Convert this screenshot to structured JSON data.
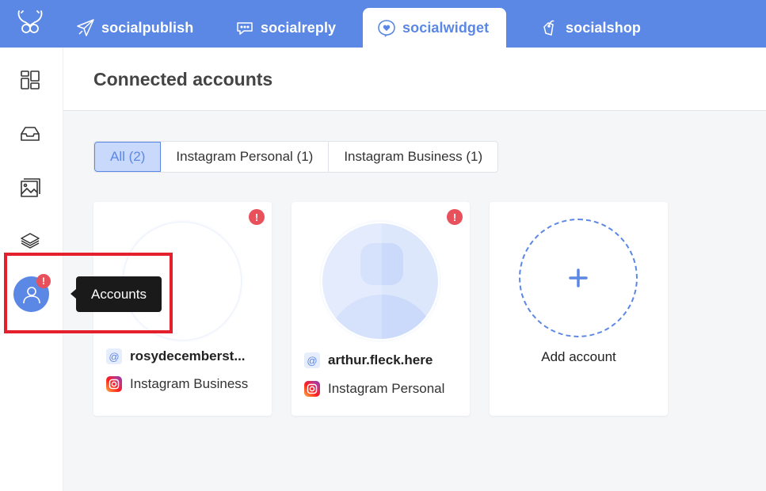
{
  "topbar": {
    "logo": "antler-logo",
    "tabs": [
      {
        "label": "socialpublish",
        "icon": "paper-plane-icon",
        "active": false
      },
      {
        "label": "socialreply",
        "icon": "chat-bubble-icon",
        "active": false
      },
      {
        "label": "socialwidget",
        "icon": "heart-bubble-icon",
        "active": true
      },
      {
        "label": "socialshop",
        "icon": "price-tag-icon",
        "active": false
      }
    ]
  },
  "sidebar": {
    "items": [
      {
        "name": "dashboard",
        "icon": "dashboard-grid-icon"
      },
      {
        "name": "inbox",
        "icon": "inbox-tray-icon"
      },
      {
        "name": "media",
        "icon": "image-gallery-icon"
      },
      {
        "name": "layers",
        "icon": "layers-icon"
      },
      {
        "name": "accounts",
        "icon": "user-icon",
        "active": true,
        "alert": "!"
      }
    ],
    "tooltip": "Accounts"
  },
  "header": {
    "title": "Connected accounts"
  },
  "filters": [
    {
      "label": "All (2)",
      "active": true
    },
    {
      "label": "Instagram Personal (1)",
      "active": false
    },
    {
      "label": "Instagram Business (1)",
      "active": false
    }
  ],
  "accounts": [
    {
      "handle": "rosydecemberst...",
      "type": "Instagram Business",
      "alert": "!",
      "at": "@"
    },
    {
      "handle": "arthur.fleck.here",
      "type": "Instagram Personal",
      "alert": "!",
      "at": "@"
    }
  ],
  "add_card": {
    "plus": "+",
    "label": "Add account"
  },
  "colors": {
    "brand": "#5b87e5",
    "alert": "#e8505b",
    "highlight": "#e3202c",
    "filter_active_bg": "#c9d9fb"
  }
}
